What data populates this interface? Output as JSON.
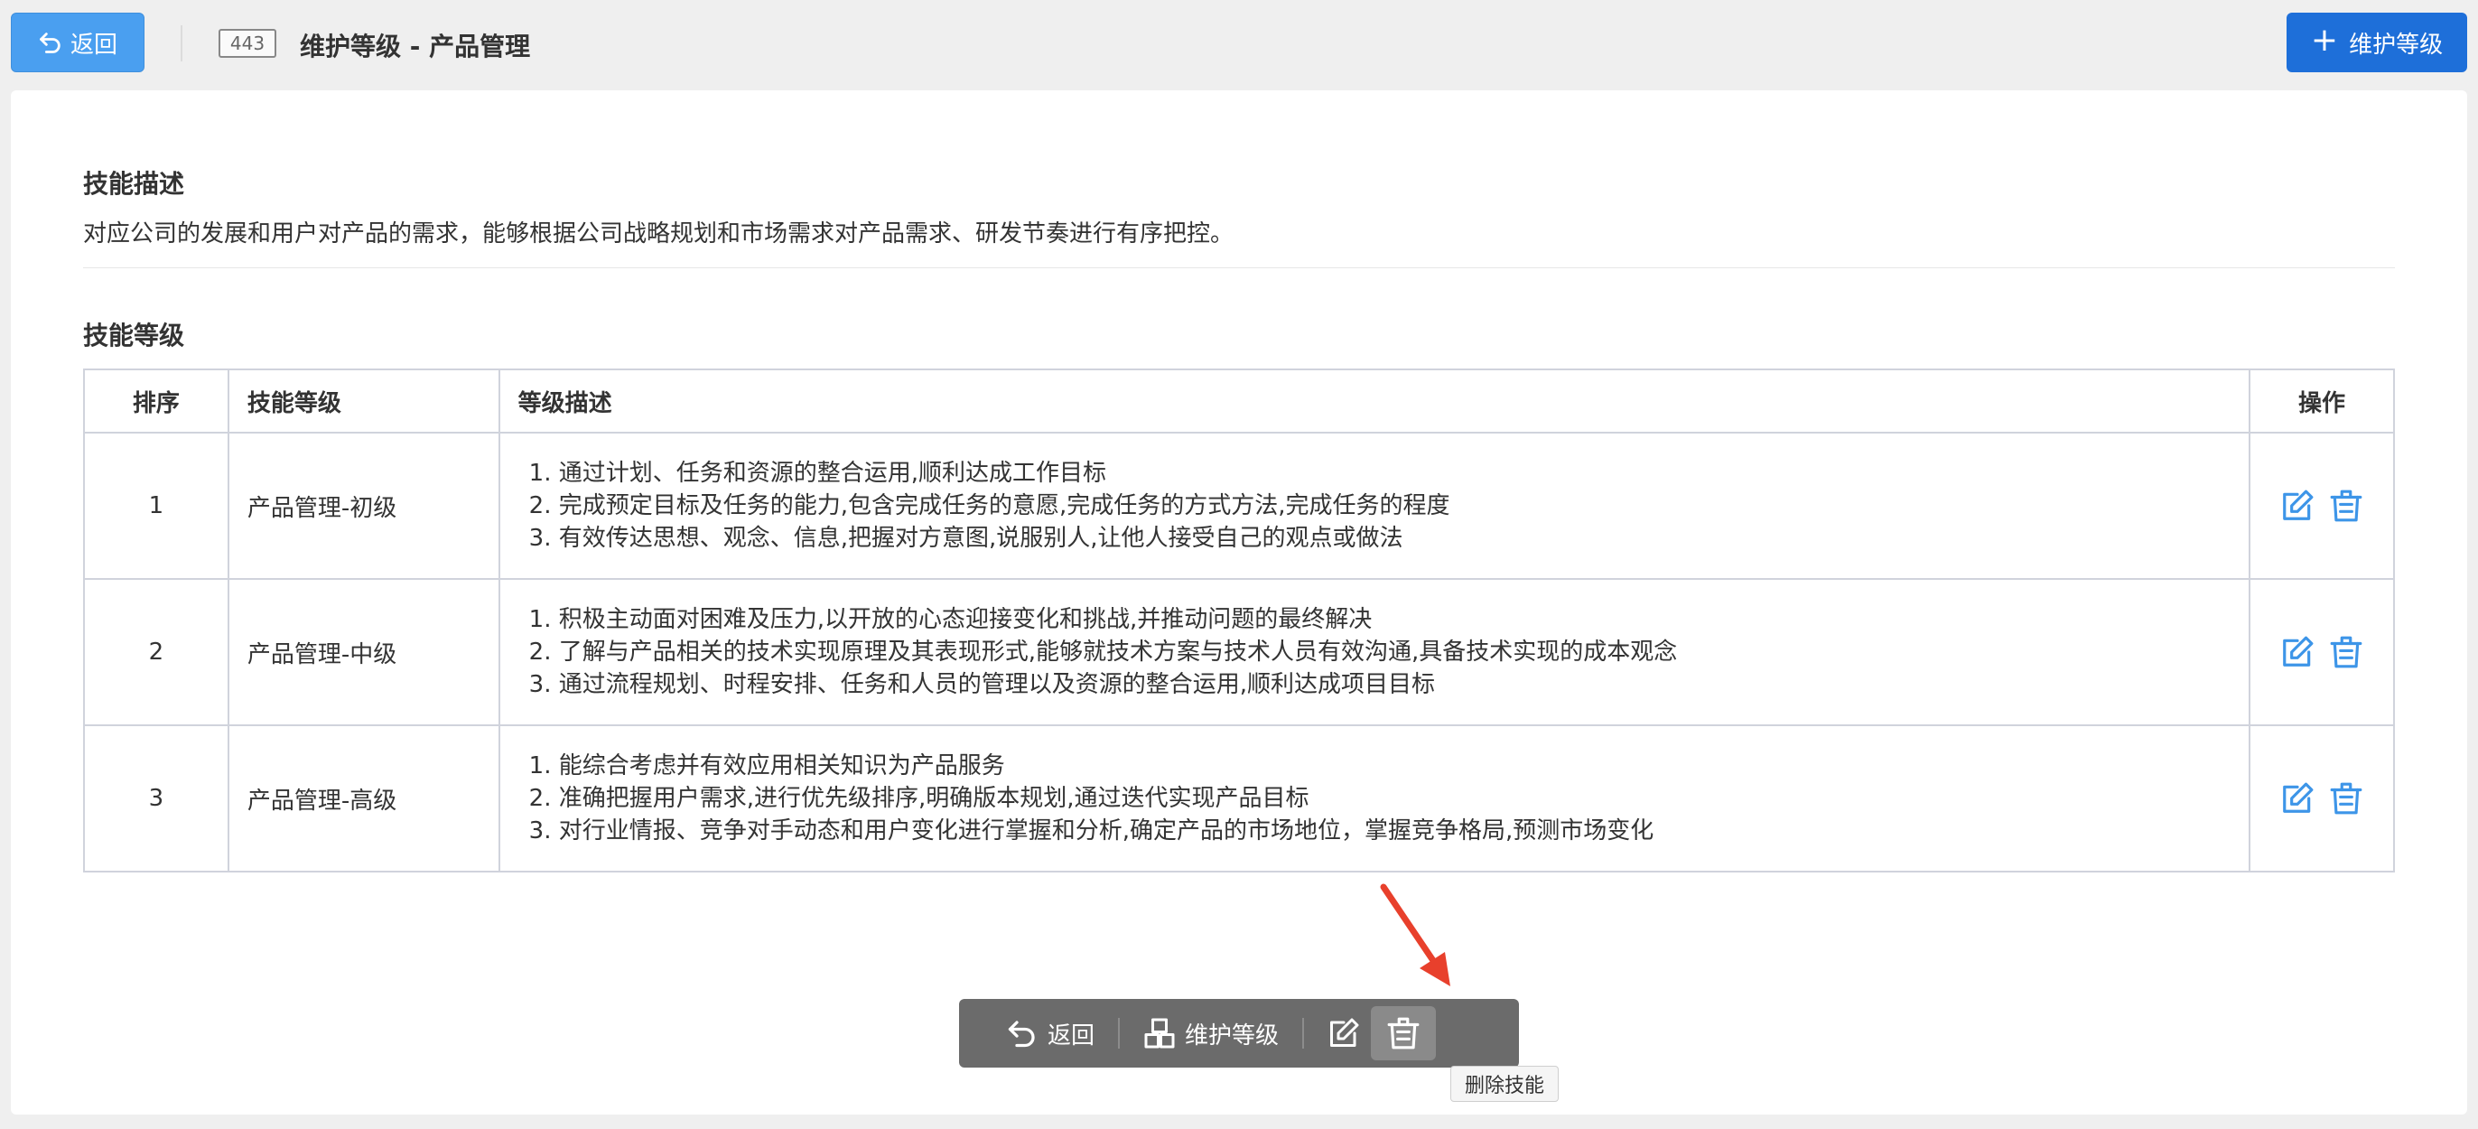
{
  "header": {
    "back_label": "返回",
    "id_badge": "443",
    "title": "维护等级 - 产品管理",
    "add_label": "维护等级"
  },
  "skill_description": {
    "heading": "技能描述",
    "text": "对应公司的发展和用户对产品的需求，能够根据公司战略规划和市场需求对产品需求、研发节奏进行有序把控。"
  },
  "skill_levels": {
    "heading": "技能等级",
    "columns": [
      "排序",
      "技能等级",
      "等级描述",
      "操作"
    ],
    "rows": [
      {
        "order": "1",
        "name": "产品管理-初级",
        "lines": [
          "1. 通过计划、任务和资源的整合运用,顺利达成工作目标",
          "2. 完成预定目标及任务的能力,包含完成任务的意愿,完成任务的方式方法,完成任务的程度",
          "3. 有效传达思想、观念、信息,把握对方意图,说服别人,让他人接受自己的观点或做法"
        ]
      },
      {
        "order": "2",
        "name": "产品管理-中级",
        "lines": [
          "1. 积极主动面对困难及压力,以开放的心态迎接变化和挑战,并推动问题的最终解决",
          "2. 了解与产品相关的技术实现原理及其表现形式,能够就技术方案与技术人员有效沟通,具备技术实现的成本观念",
          "3. 通过流程规划、时程安排、任务和人员的管理以及资源的整合运用,顺利达成项目目标"
        ]
      },
      {
        "order": "3",
        "name": "产品管理-高级",
        "lines": [
          "1. 能综合考虑并有效应用相关知识为产品服务",
          "2. 准确把握用户需求,进行优先级排序,明确版本规划,通过迭代实现产品目标",
          "3. 对行业情报、竞争对手动态和用户变化进行掌握和分析,确定产品的市场地位，掌握竞争格局,预测市场变化"
        ]
      }
    ]
  },
  "floating_toolbar": {
    "back_label": "返回",
    "maintain_label": "维护等级",
    "tooltip": "删除技能"
  },
  "colors": {
    "primary": "#1e6fd9",
    "back_button": "#4a9ff0",
    "icon_blue": "#3d95e8",
    "toolbar_bg": "#6b6b6b",
    "arrow": "#e8402c"
  }
}
